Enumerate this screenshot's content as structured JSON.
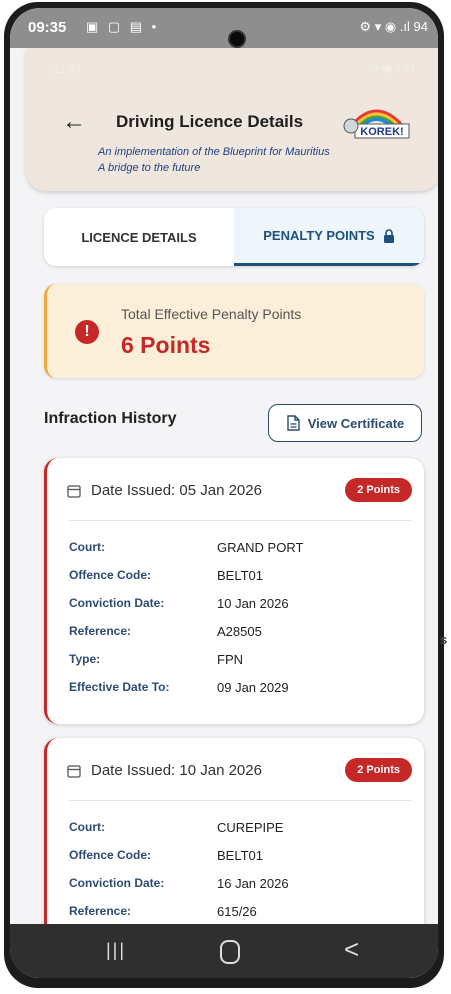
{
  "device_status": {
    "time": "09:35",
    "left_icons": "▣ ▢ ▤ •",
    "right_icons": "⚙ ▾ ◉ .ıl 94"
  },
  "app_status": {
    "time": "11:45",
    "right": "◔ ◉ ıl 71"
  },
  "header": {
    "back_label": "←",
    "title": "Driving Licence Details",
    "logo_text": "KOREK!",
    "tagline1": "An implementation of the Blueprint for Mauritius",
    "tagline2": "A bridge to the future"
  },
  "tabs": [
    {
      "label": "LICENCE DETAILS"
    },
    {
      "label": "PENALTY POINTS"
    }
  ],
  "alert": {
    "icon": "!",
    "label": "Total Effective Penalty Points",
    "value": "6 Points"
  },
  "infraction": {
    "title": "Infraction History",
    "button": "View Certificate"
  },
  "cards": [
    {
      "date": "Date Issued: 05 Jan 2026",
      "badge": "2 Points",
      "rows": [
        {
          "label": "Court:",
          "value": "GRAND PORT"
        },
        {
          "label": "Offence Code:",
          "value": "BELT01"
        },
        {
          "label": "Conviction Date:",
          "value": "10 Jan 2026"
        },
        {
          "label": "Reference:",
          "value": "A28505"
        },
        {
          "label": "Type:",
          "value": "FPN"
        },
        {
          "label": "Effective Date To:",
          "value": "09 Jan 2029"
        }
      ]
    },
    {
      "date": "Date Issued: 10 Jan 2026",
      "badge": "2 Points",
      "rows": [
        {
          "label": "Court:",
          "value": "CUREPIPE"
        },
        {
          "label": "Offence Code:",
          "value": "BELT01"
        },
        {
          "label": "Conviction Date:",
          "value": "16 Jan 2026"
        },
        {
          "label": "Reference:",
          "value": "615/26"
        }
      ]
    }
  ],
  "navbar": {
    "recent": "|||",
    "back": "<"
  },
  "side_text": "s",
  "colors": {
    "accent_red": "#c62828",
    "navy": "#1d4f7f",
    "header_bg": "#efe7dd",
    "alert_bg": "#fcefd9"
  }
}
